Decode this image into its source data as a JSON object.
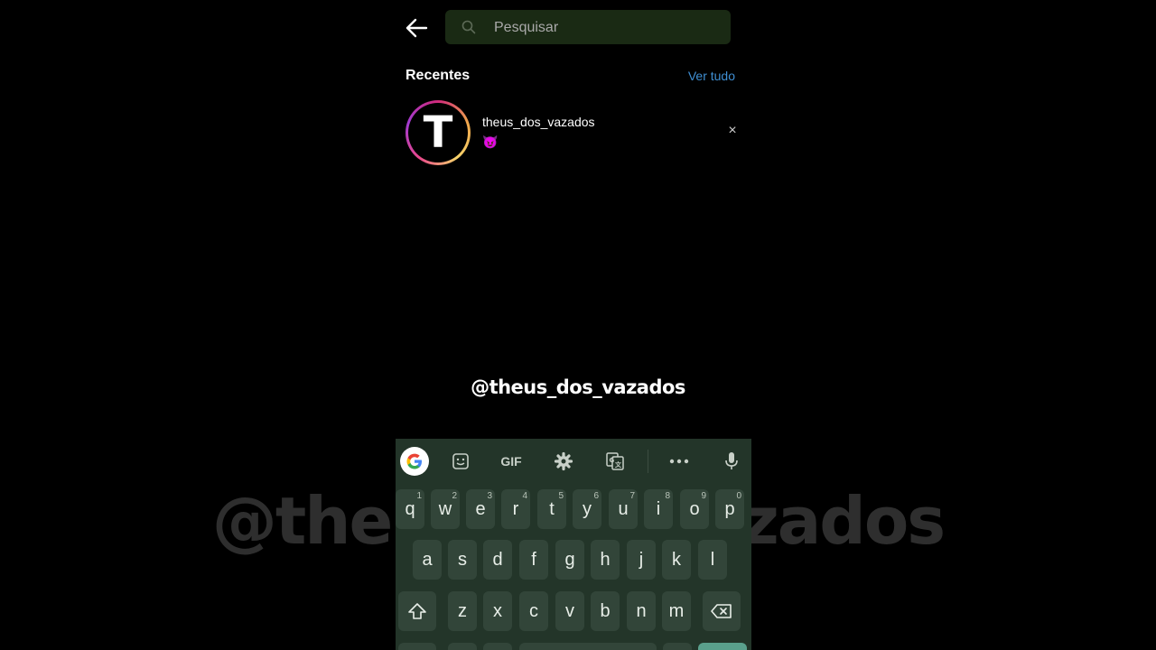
{
  "watermark_text": "@theus_dos_vazados",
  "search": {
    "placeholder": "Pesquisar",
    "value": ""
  },
  "recent": {
    "title": "Recentes",
    "see_all": "Ver tudo",
    "items": [
      {
        "avatar_letter": "T",
        "username": "theus_dos_vazados",
        "subtitle": "😈",
        "remove": "×"
      }
    ]
  },
  "overlay_handle": "@theus_dos_vazados",
  "keyboard": {
    "toolbar": {
      "gif": "GIF",
      "icons": [
        "google-icon",
        "sticker-icon",
        "gif-button",
        "settings-icon",
        "translate-icon",
        "more-icon",
        "mic-icon"
      ]
    },
    "row1": [
      {
        "k": "q",
        "n": "1"
      },
      {
        "k": "w",
        "n": "2"
      },
      {
        "k": "e",
        "n": "3"
      },
      {
        "k": "r",
        "n": "4"
      },
      {
        "k": "t",
        "n": "5"
      },
      {
        "k": "y",
        "n": "6"
      },
      {
        "k": "u",
        "n": "7"
      },
      {
        "k": "i",
        "n": "8"
      },
      {
        "k": "o",
        "n": "9"
      },
      {
        "k": "p",
        "n": "0"
      }
    ],
    "row2": [
      "a",
      "s",
      "d",
      "f",
      "g",
      "h",
      "j",
      "k",
      "l"
    ],
    "row3": [
      "z",
      "x",
      "c",
      "v",
      "b",
      "n",
      "m"
    ]
  },
  "colors": {
    "background": "#000000",
    "search_bg": "#1a2a14",
    "link_blue": "#3f8fd3",
    "keyboard_bg": "#233529",
    "key_bg": "#324539"
  }
}
